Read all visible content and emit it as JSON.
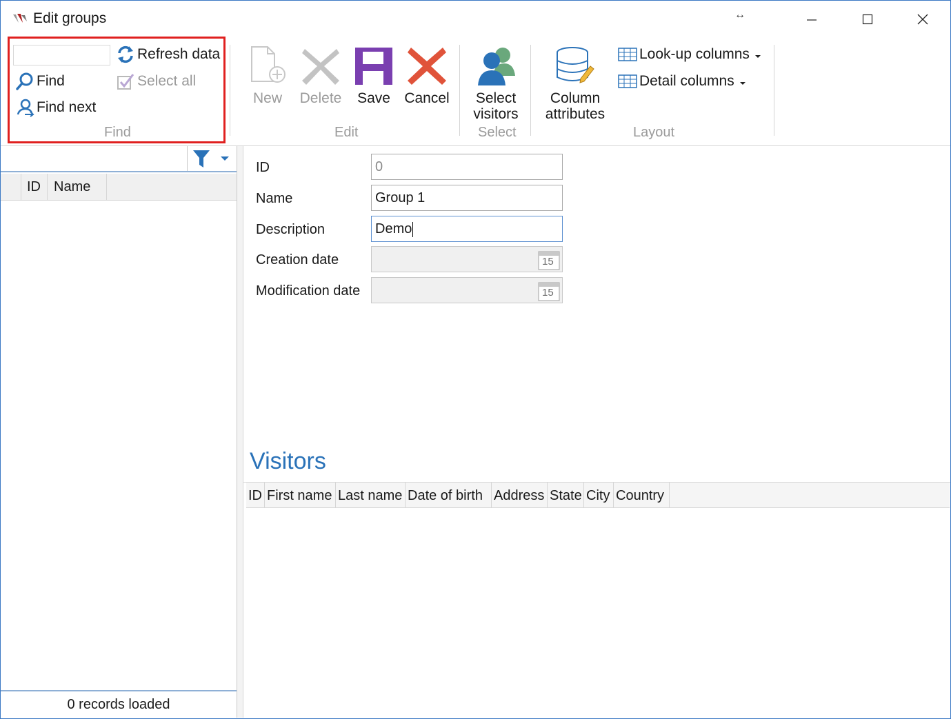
{
  "window": {
    "title": "Edit groups",
    "resize_glyph": "↔"
  },
  "ribbon": {
    "find_group": {
      "label": "Find",
      "find_input_value": "",
      "find_label": "Find",
      "find_next_label": "Find next",
      "refresh_label": "Refresh data",
      "select_all_label": "Select all"
    },
    "edit_group": {
      "label": "Edit",
      "new_label": "New",
      "delete_label": "Delete",
      "save_label": "Save",
      "cancel_label": "Cancel"
    },
    "select_group": {
      "label": "Select",
      "select_visitors_line1": "Select",
      "select_visitors_line2": "visitors"
    },
    "layout_group": {
      "label": "Layout",
      "column_attributes_line1": "Column",
      "column_attributes_line2": "attributes",
      "lookup_columns_label": "Look-up columns",
      "detail_columns_label": "Detail columns"
    }
  },
  "left_panel": {
    "filter_value": "",
    "columns": [
      "ID",
      "Name"
    ],
    "status": "0 records loaded"
  },
  "form": {
    "id_label": "ID",
    "id_value": "0",
    "name_label": "Name",
    "name_value": "Group 1",
    "description_label": "Description",
    "description_value": "Demo",
    "creation_date_label": "Creation date",
    "creation_date_value": "",
    "modification_date_label": "Modification date",
    "modification_date_value": "",
    "calendar_icon_text": "15"
  },
  "visitors": {
    "title": "Visitors",
    "columns": [
      "ID",
      "First name",
      "Last name",
      "Date of birth",
      "Address",
      "State",
      "City",
      "Country"
    ]
  },
  "colors": {
    "accent_blue": "#2a72b8",
    "highlight_red": "#e0201f",
    "save_purple": "#7a3fb0",
    "cancel_red": "#e0533a"
  }
}
